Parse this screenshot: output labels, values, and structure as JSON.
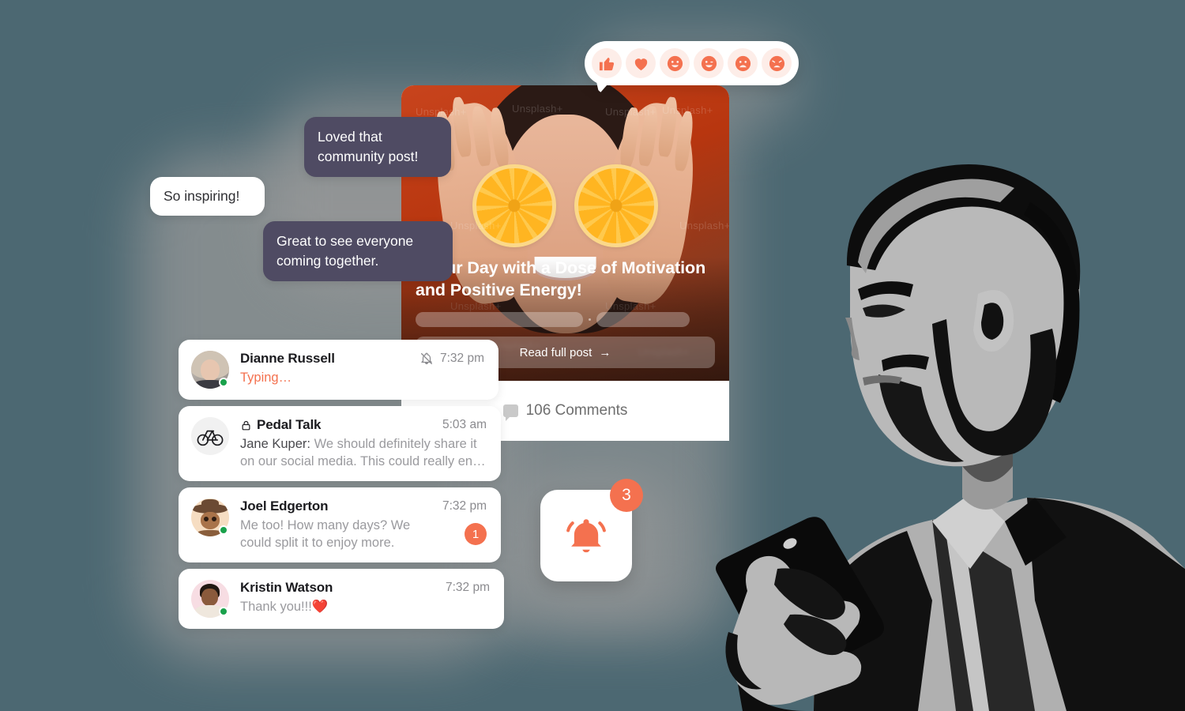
{
  "theme": {
    "background": "#4C6872",
    "accent": "#F4714F",
    "bubble_dark": "#4F4B63",
    "online": "#19A14B",
    "card": "#FFFFFF"
  },
  "reactions": {
    "items": [
      {
        "name": "thumbs-up-reaction",
        "icon": "thumbs-up-icon"
      },
      {
        "name": "love-reaction",
        "icon": "heart-icon"
      },
      {
        "name": "smile-reaction",
        "icon": "smile-icon"
      },
      {
        "name": "wink-reaction",
        "icon": "wink-icon"
      },
      {
        "name": "sad-reaction",
        "icon": "sad-icon"
      },
      {
        "name": "angry-reaction",
        "icon": "angry-icon"
      }
    ]
  },
  "chat_bubbles": [
    {
      "text": "Loved that community post!",
      "style": "dark"
    },
    {
      "text": "So inspiring!",
      "style": "light"
    },
    {
      "text": "Great to see everyone coming together.",
      "style": "dark"
    }
  ],
  "post": {
    "title": ": Your Day with a Dose of Motivation and Positive Energy!",
    "image_watermark": "Unsplash+",
    "read_button": "Read full post",
    "read_button_arrow": "→",
    "comments_count": "106 Comments",
    "comments_icon": "comment-bubble-icon"
  },
  "messages": [
    {
      "name": "Dianne Russell",
      "time": "7:32 pm",
      "preview": "Typing…",
      "preview_type": "typing",
      "muted": true,
      "muted_icon": "bell-muted-icon",
      "online": true,
      "avatar": "dianne-avatar",
      "unread": null,
      "locked": false
    },
    {
      "name": "Pedal Talk",
      "time": "5:03 am",
      "sender": "Jane Kuper:",
      "preview": " We should definitely share it on our social media. This could really en…",
      "preview_type": "group",
      "muted": false,
      "online": false,
      "avatar": "bicycle-avatar",
      "avatar_icon": "bicycle-icon",
      "unread": null,
      "locked": true,
      "lock_icon": "lock-icon"
    },
    {
      "name": "Joel Edgerton",
      "time": "7:32 pm",
      "preview": "Me too! How many days? We could split it to enjoy more.",
      "preview_type": "text",
      "muted": false,
      "online": true,
      "avatar": "joel-avatar",
      "unread": "1",
      "locked": false
    },
    {
      "name": "Kristin Watson",
      "time": "7:32 pm",
      "preview": "Thank you!!!❤️",
      "preview_type": "text",
      "muted": false,
      "online": true,
      "avatar": "kristin-avatar",
      "unread": null,
      "locked": false
    }
  ],
  "notification": {
    "icon": "bell-icon",
    "count": "3"
  }
}
